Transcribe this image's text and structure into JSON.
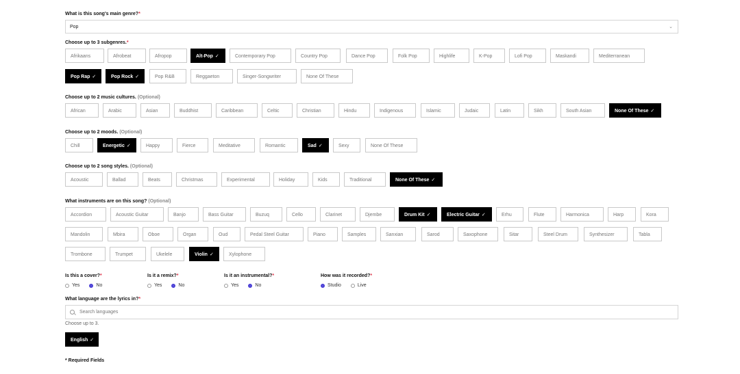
{
  "genre": {
    "label": "What is this song's main genre?",
    "required_mark": "*",
    "value": "Pop",
    "chevron": "⌄"
  },
  "subgenres": {
    "label": "Choose up to 3 subgenres.",
    "required_mark": "*",
    "items": [
      "Afrikaans",
      "Afrobeat",
      "Afropop",
      "Alt-Pop",
      "Contemporary Pop",
      "Country Pop",
      "Dance Pop",
      "Folk Pop",
      "Highlife",
      "K-Pop",
      "Lofi Pop",
      "Maskandi",
      "Mediterranean",
      "Pop Rap",
      "Pop Rock",
      "Pop R&B",
      "Reggaeton",
      "Singer-Songwriter",
      "None Of These"
    ],
    "selected": [
      "Alt-Pop",
      "Pop Rap",
      "Pop Rock"
    ]
  },
  "cultures": {
    "label": "Choose up to 2 music cultures.",
    "optional": "(Optional)",
    "items": [
      "African",
      "Arabic",
      "Asian",
      "Buddhist",
      "Caribbean",
      "Celtic",
      "Christian",
      "Hindu",
      "Indigenous",
      "Islamic",
      "Judaic",
      "Latin",
      "Sikh",
      "South Asian",
      "None Of These"
    ],
    "selected": [
      "None Of These"
    ]
  },
  "moods": {
    "label": "Choose up to 2 moods.",
    "optional": "(Optional)",
    "items": [
      "Chill",
      "Energetic",
      "Happy",
      "Fierce",
      "Meditative",
      "Romantic",
      "Sad",
      "Sexy",
      "None Of These"
    ],
    "selected": [
      "Energetic",
      "Sad"
    ]
  },
  "styles": {
    "label": "Choose up to 2 song styles.",
    "optional": "(Optional)",
    "items": [
      "Acoustic",
      "Ballad",
      "Beats",
      "Christmas",
      "Experimental",
      "Holiday",
      "Kids",
      "Traditional",
      "None Of These"
    ],
    "selected": [
      "None Of These"
    ]
  },
  "instruments": {
    "label": "What instruments are on this song?",
    "optional": "(Optional)",
    "items": [
      "Accordion",
      "Acoustic Guitar",
      "Banjo",
      "Bass Guitar",
      "Buzuq",
      "Cello",
      "Clarinet",
      "Djembe",
      "Drum Kit",
      "Electric Guitar",
      "Erhu",
      "Flute",
      "Harmonica",
      "Harp",
      "Kora",
      "Mandolin",
      "Mbira",
      "Oboe",
      "Organ",
      "Oud",
      "Pedal Steel Guitar",
      "Piano",
      "Samples",
      "Sanxian",
      "Sarod",
      "Saxophone",
      "Sitar",
      "Steel Drum",
      "Synthesizer",
      "Tabla",
      "Trombone",
      "Trumpet",
      "Ukelele",
      "Violin",
      "Xylophone"
    ],
    "selected": [
      "Drum Kit",
      "Electric Guitar",
      "Violin"
    ]
  },
  "check": "✓",
  "cover": {
    "label": "Is this a cover?",
    "required_mark": "*",
    "options": [
      "Yes",
      "No"
    ],
    "selected": "No"
  },
  "remix": {
    "label": "Is it a remix?",
    "required_mark": "*",
    "options": [
      "Yes",
      "No"
    ],
    "selected": "No"
  },
  "instrumental": {
    "label": "Is it an instrumental?",
    "required_mark": "*",
    "options": [
      "Yes",
      "No"
    ],
    "selected": "No"
  },
  "recorded": {
    "label": "How was it recorded?",
    "required_mark": "*",
    "options": [
      "Studio",
      "Live"
    ],
    "selected": "Studio"
  },
  "language": {
    "label": "What language are the lyrics in?",
    "required_mark": "*",
    "placeholder": "Search languages",
    "hint": "Choose up to 3.",
    "selected": [
      "English"
    ]
  },
  "footer": {
    "required_note": "* Required Fields"
  },
  "colors": {
    "accent": "#4a3fd6",
    "required": "#e0344a",
    "selected_chip": "#000000"
  }
}
